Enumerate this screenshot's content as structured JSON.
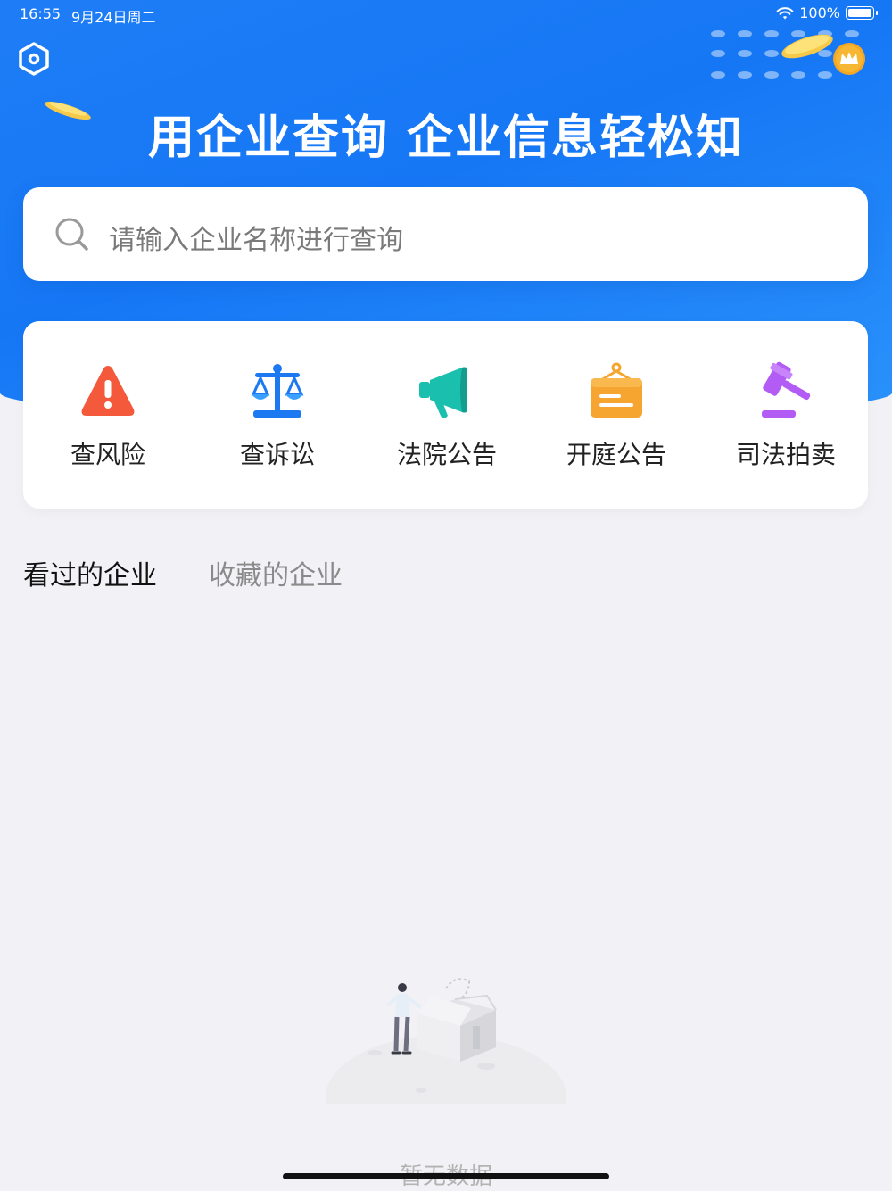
{
  "status_bar": {
    "time": "16:55",
    "date": "9月24日周二",
    "battery": "100%"
  },
  "header": {
    "title": "用企业查询 企业信息轻松知",
    "settings_icon": "settings-hexagon-icon",
    "vip_icon": "crown-icon"
  },
  "search": {
    "placeholder": "请输入企业名称进行查询"
  },
  "quick_actions": [
    {
      "label": "查风险",
      "icon": "warning-triangle-icon",
      "color": "#f4593b"
    },
    {
      "label": "查诉讼",
      "icon": "scale-icon",
      "color": "#1c79f2"
    },
    {
      "label": "法院公告",
      "icon": "megaphone-icon",
      "color": "#1bbfae"
    },
    {
      "label": "开庭公告",
      "icon": "notice-board-icon",
      "color": "#f7a531"
    },
    {
      "label": "司法拍卖",
      "icon": "gavel-icon",
      "color": "#b35cf5"
    }
  ],
  "tabs": [
    {
      "label": "看过的企业",
      "active": true
    },
    {
      "label": "收藏的企业",
      "active": false
    }
  ],
  "empty_state": {
    "text": "暂无数据"
  },
  "colors": {
    "brand_blue": "#1677f5",
    "background": "#f2f2f6"
  }
}
